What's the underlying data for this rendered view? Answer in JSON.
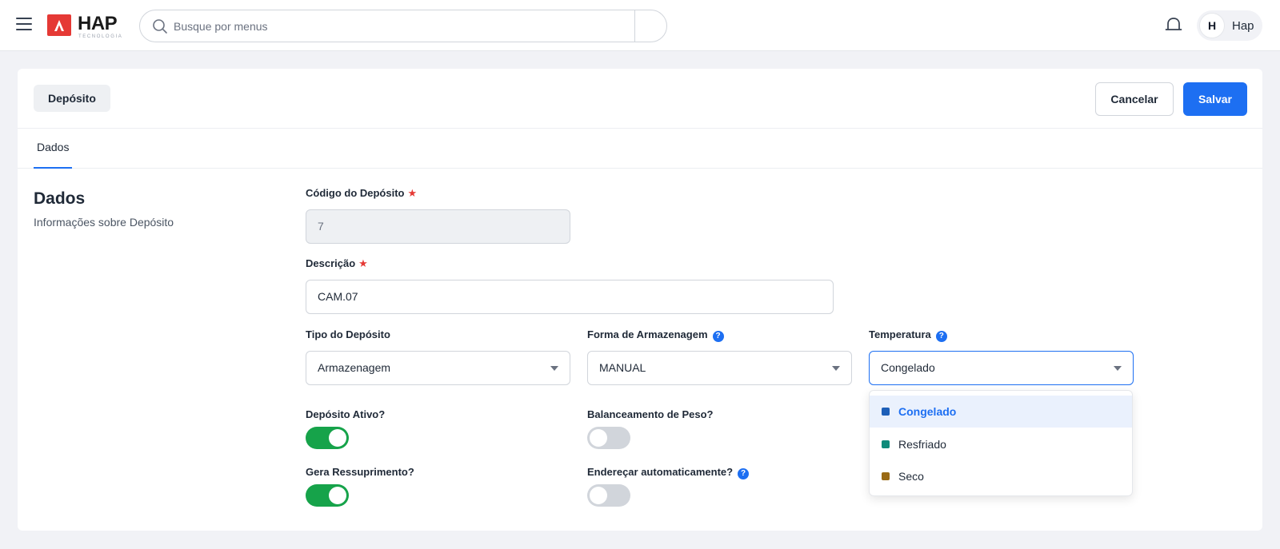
{
  "topbar": {
    "logo_text": "HAP",
    "logo_sub": "TECNOLOGIA",
    "search_placeholder": "Busque por menus",
    "user_initial": "H",
    "user_name": "Hap"
  },
  "header": {
    "breadcrumb": "Depósito",
    "cancel_label": "Cancelar",
    "save_label": "Salvar"
  },
  "tabs": [
    {
      "label": "Dados",
      "active": true
    }
  ],
  "section": {
    "title": "Dados",
    "description": "Informações sobre Depósito"
  },
  "form": {
    "codigo": {
      "label": "Código do Depósito",
      "required_mark": "★",
      "value": "7"
    },
    "descricao": {
      "label": "Descrição",
      "required_mark": "★",
      "value": "CAM.07"
    },
    "tipo": {
      "label": "Tipo do Depósito",
      "value": "Armazenagem"
    },
    "forma": {
      "label": "Forma de Armazenagem",
      "help": "?",
      "value": "MANUAL"
    },
    "temperatura": {
      "label": "Temperatura",
      "help": "?",
      "value": "Congelado"
    },
    "ativo": {
      "label": "Depósito Ativo?",
      "on": true
    },
    "balanceamento": {
      "label": "Balanceamento de Peso?",
      "on": false
    },
    "ressuprimento": {
      "label": "Gera Ressuprimento?",
      "on": true
    },
    "enderecar": {
      "label": "Endereçar automaticamente?",
      "help": "?",
      "on": false
    }
  },
  "temperatura_options": [
    {
      "label": "Congelado",
      "color": "#1d5fb8",
      "selected": true
    },
    {
      "label": "Resfriado",
      "color": "#0f8a7a",
      "selected": false
    },
    {
      "label": "Seco",
      "color": "#9a6a14",
      "selected": false
    }
  ],
  "colors": {
    "primary": "#1d6ff2",
    "toggle_on": "#16a34a",
    "toggle_off": "#d1d5db",
    "required": "#e53935",
    "logo": "#e53935"
  }
}
